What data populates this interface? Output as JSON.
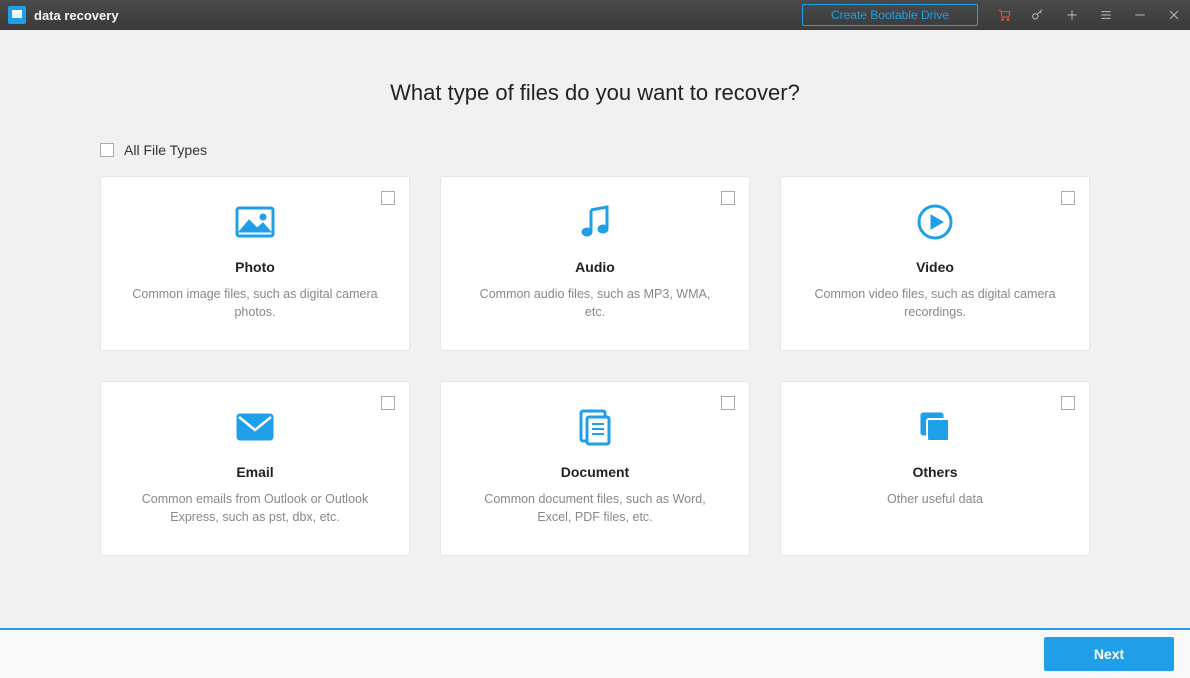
{
  "titlebar": {
    "appName": "data recovery",
    "bootableLabel": "Create Bootable Drive"
  },
  "heading": "What type of files do you want to recover?",
  "allTypesLabel": "All File Types",
  "cards": [
    {
      "title": "Photo",
      "desc": "Common image files, such as digital camera photos."
    },
    {
      "title": "Audio",
      "desc": "Common audio files, such as MP3, WMA, etc."
    },
    {
      "title": "Video",
      "desc": "Common video files, such as digital camera recordings."
    },
    {
      "title": "Email",
      "desc": "Common emails from Outlook or Outlook Express, such as pst, dbx, etc."
    },
    {
      "title": "Document",
      "desc": "Common document files, such as Word, Excel, PDF files, etc."
    },
    {
      "title": "Others",
      "desc": "Other useful data"
    }
  ],
  "footer": {
    "nextLabel": "Next"
  },
  "colors": {
    "accent": "#1e9fe8"
  }
}
